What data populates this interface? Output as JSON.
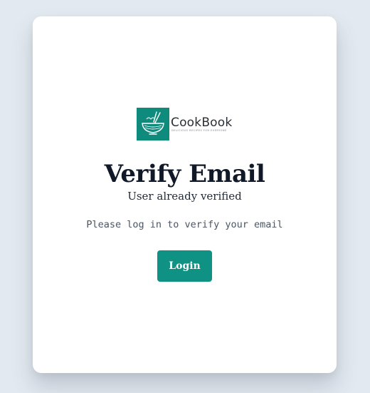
{
  "brand": {
    "name": "CookBook",
    "tagline": "DELICIOUS RECIPES FOR EVERYONE",
    "logo_icon": "noodle-bowl-icon",
    "accent_color": "#0f8b7e"
  },
  "page": {
    "title": "Verify Email",
    "subtitle": "User already verified",
    "message": "Please log in to verify your email"
  },
  "actions": {
    "login_label": "Login",
    "login_color": "#0f9183"
  }
}
